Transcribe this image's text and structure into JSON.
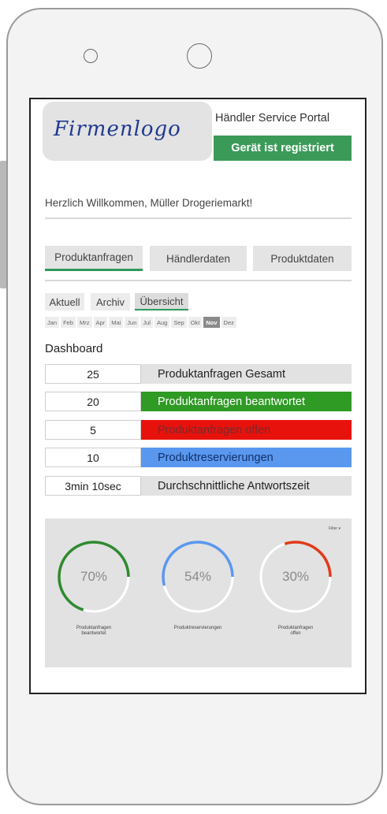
{
  "header": {
    "logo_text": "Firmenlogo",
    "portal_title": "Händler Service Portal",
    "registration_status": "Gerät ist registriert"
  },
  "welcome_text": "Herzlich Willkommen, Müller Drogeriemarkt!",
  "tabs": [
    {
      "label": "Produktanfragen",
      "active": true
    },
    {
      "label": "Händlerdaten",
      "active": false
    },
    {
      "label": "Produktdaten",
      "active": false
    }
  ],
  "subtabs": [
    {
      "label": "Aktuell",
      "active": false
    },
    {
      "label": "Archiv",
      "active": false
    },
    {
      "label": "Übersicht",
      "active": true
    }
  ],
  "months": [
    "Jan",
    "Feb",
    "Mrz",
    "Apr",
    "Mai",
    "Jun",
    "Jul",
    "Aug",
    "Sep",
    "Okt",
    "Nov",
    "Dez"
  ],
  "selected_month": "Nov",
  "dashboard": {
    "title": "Dashboard",
    "stats": [
      {
        "value": "25",
        "label": "Produktanfragen Gesamt",
        "bg": "#e2e2e2",
        "color": "#222222"
      },
      {
        "value": "20",
        "label": "Produktanfragen beantwortet",
        "bg": "#2f9a24",
        "color": "#ffffff"
      },
      {
        "value": "5",
        "label": "Produktanfragen offen",
        "bg": "#e8120d",
        "color": "#7a2a2a"
      },
      {
        "value": "10",
        "label": "Produktreservierungen",
        "bg": "#5a98f0",
        "color": "#12306a"
      },
      {
        "value": "3min 10sec",
        "label": "Durchschnittliche Antwortszeit",
        "bg": "#e2e2e2",
        "color": "#222222"
      }
    ]
  },
  "chart_data": {
    "type": "donut",
    "menu_label": "Filter",
    "series": [
      {
        "name": "Produktanfragen beantwortet",
        "value": 70,
        "display": "70%",
        "caption_line1": "Produktanfragen",
        "caption_line2": "beantwortet",
        "color": "#2f8a2f"
      },
      {
        "name": "Produktreservierungen",
        "value": 54,
        "display": "54%",
        "caption_line1": "Produktreservierungen",
        "caption_line2": "",
        "color": "#5a98f0"
      },
      {
        "name": "Produktanfragen offen",
        "value": 30,
        "display": "30%",
        "caption_line1": "Produktanfragen",
        "caption_line2": "offen",
        "color": "#e03a1a"
      }
    ]
  }
}
